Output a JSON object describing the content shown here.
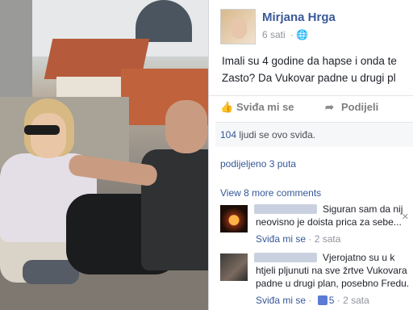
{
  "post": {
    "author": "Mirjana Hrga",
    "time": "6 sati",
    "privacy_icon": "globe-icon",
    "text_line1": "Imali su 4 godine da hapse i onda te",
    "text_line2": "Zasto? Da Vukovar padne u drugi pl",
    "like_label": "Sviđa mi se",
    "share_label": "Podijeli",
    "likes_count": "104",
    "likes_text": " ljudi se ovo sviđa.",
    "shares_text": "podijeljeno 3 puta",
    "more_comments": "View 8 more comments"
  },
  "comments": [
    {
      "line1": "Siguran sam da nij",
      "line2": "neovisno je doista prica za sebe...",
      "like_label": "Sviđa mi se",
      "sep": " · ",
      "time": "2 sata"
    },
    {
      "line1": "Vjerojatno su u k",
      "line2": "htjeli pljunuti na sve žrtve Vukovara",
      "line3": "padne u drugi plan, posebno Fredu.",
      "like_label": "Sviđa mi se",
      "sep": " · ",
      "likes": "5",
      "time": "2 sata"
    }
  ],
  "colors": {
    "link": "#365899",
    "author": "#3b5998",
    "meta": "#90949c"
  }
}
